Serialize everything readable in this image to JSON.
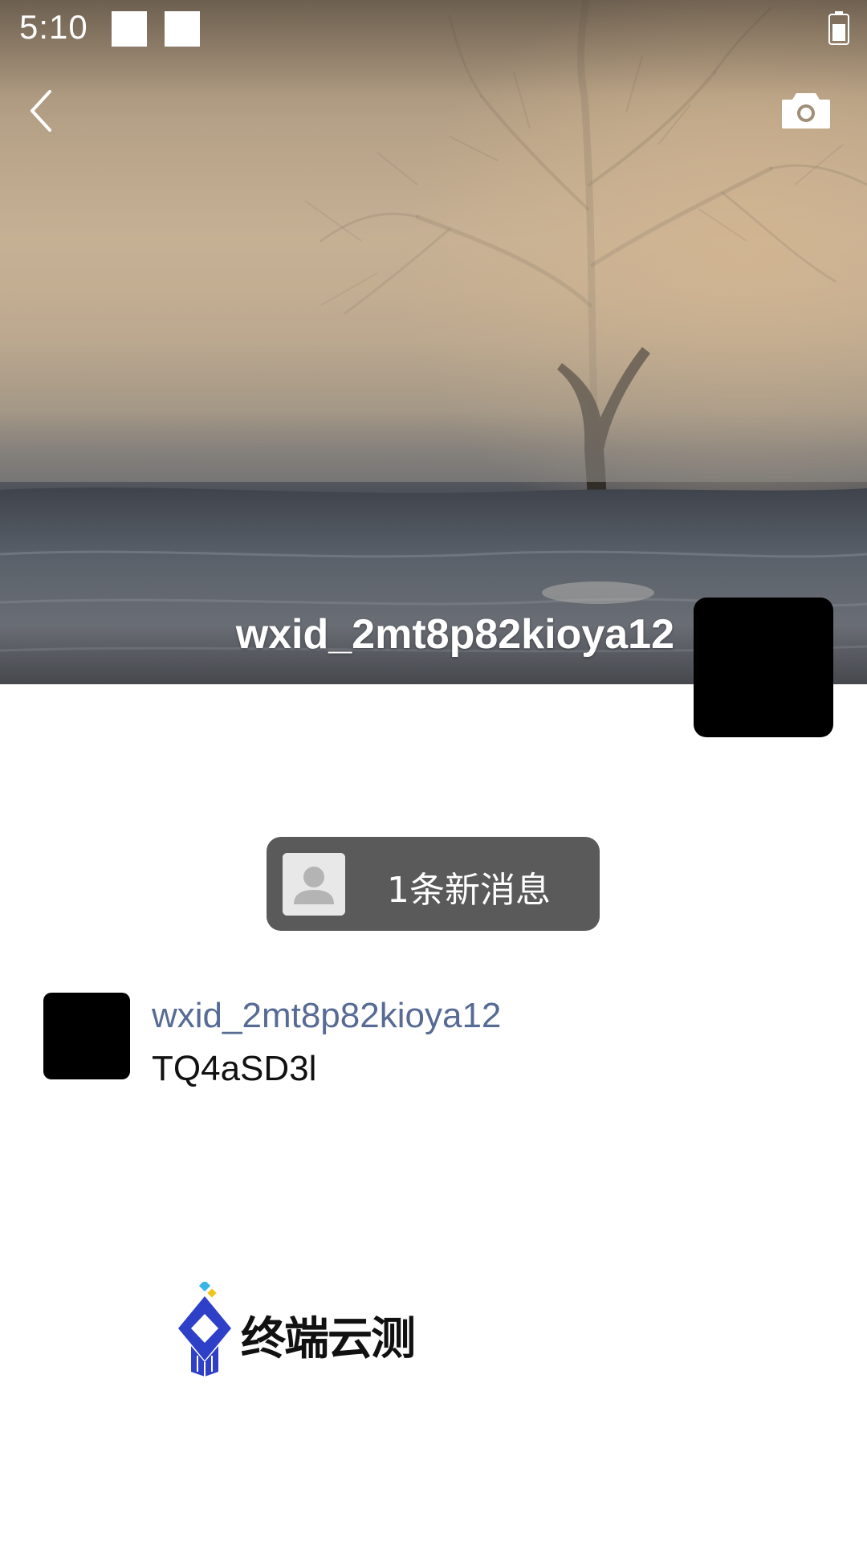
{
  "status_bar": {
    "time": "5:10",
    "battery_icon": "battery-icon",
    "notification_icons": [
      "notification-icon",
      "notification-icon"
    ]
  },
  "header": {
    "back_icon": "chevron-left-icon",
    "camera_icon": "camera-icon"
  },
  "profile": {
    "name": "wxid_2mt8p82kioya12",
    "cover_image": "misty tree in winter landscape",
    "avatar": "avatar"
  },
  "notification": {
    "label": "1条新消息",
    "avatar_icon": "default-avatar-icon"
  },
  "post": {
    "author": "wxid_2mt8p82kioya12",
    "content": "TQ4aSD3l"
  },
  "watermark": {
    "text": "终端云测"
  },
  "colors": {
    "author_link": "#576b95",
    "pill_background": "#5a5a5a",
    "background": "#ffffff"
  }
}
